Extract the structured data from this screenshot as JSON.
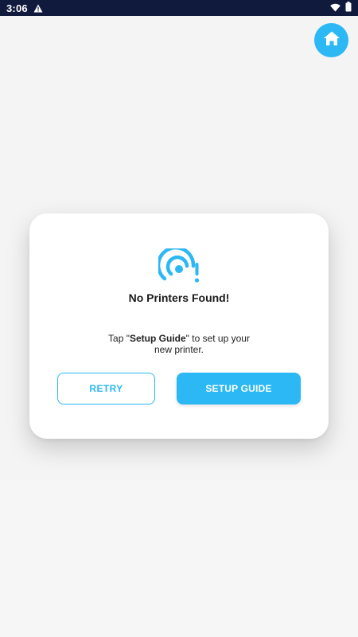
{
  "status_bar": {
    "time": "3:06",
    "alert_icon": "warning-triangle-icon",
    "wifi_icon": "wifi-icon",
    "battery_icon": "battery-icon",
    "background_color": "#0f1a3c"
  },
  "home_button": {
    "icon": "home-icon",
    "color": "#2bb8f4"
  },
  "dialog": {
    "icon": "printer-signal-warning-icon",
    "title": "No Printers Found!",
    "message": {
      "prefix": "Tap \"",
      "highlight": "Setup Guide",
      "suffix": "\" to set up your new printer."
    },
    "retry_label": "RETRY",
    "setup_label": "SETUP GUIDE",
    "accent_color": "#2bb8f4"
  }
}
